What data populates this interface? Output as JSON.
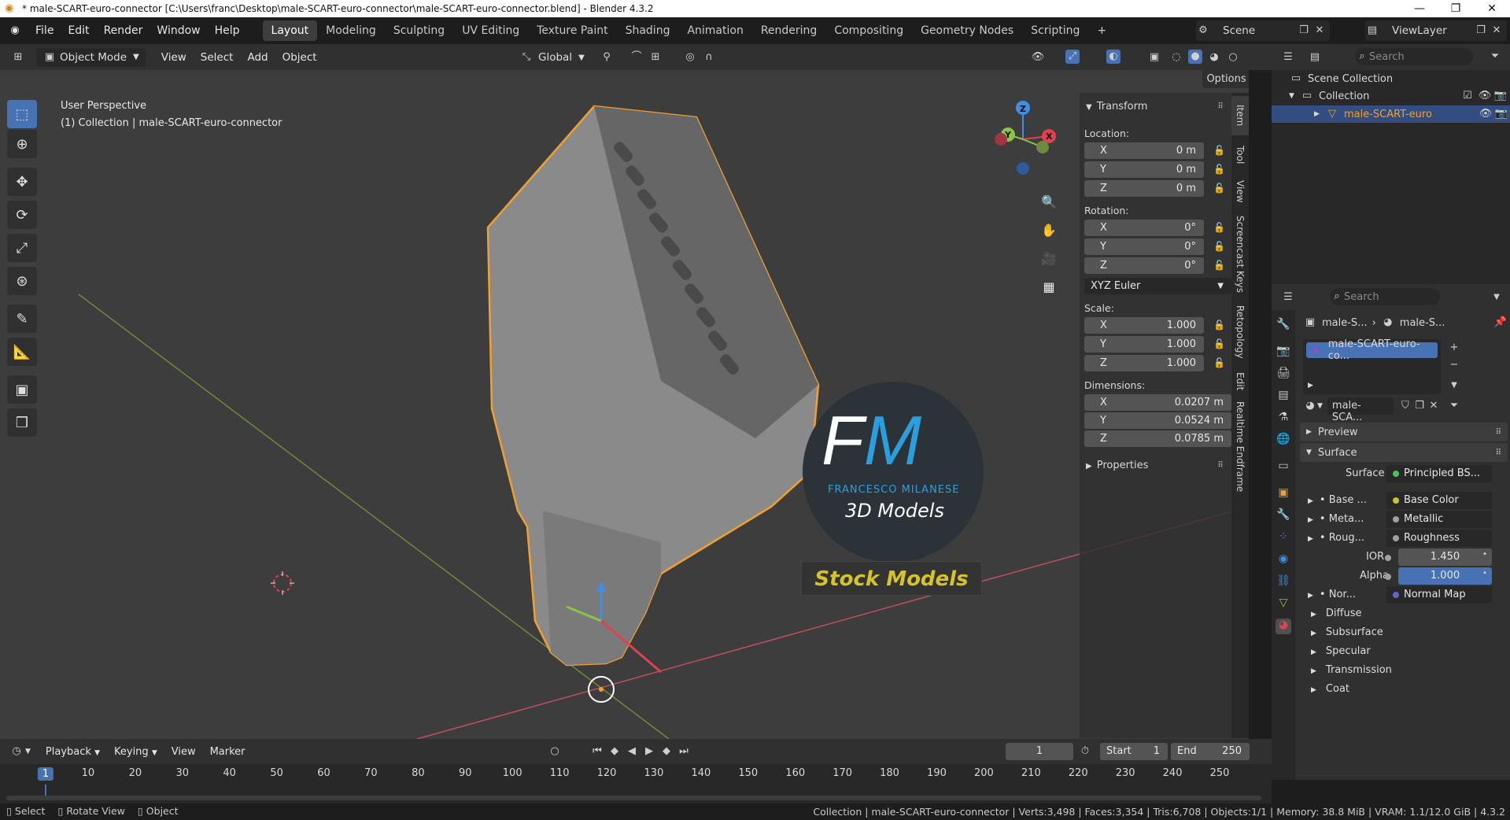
{
  "window": {
    "title": "* male-SCART-euro-connector [C:\\Users\\franc\\Desktop\\male-SCART-euro-connector\\male-SCART-euro-connector.blend] - Blender 4.3.2"
  },
  "menu": [
    "File",
    "Edit",
    "Render",
    "Window",
    "Help"
  ],
  "workspaces": [
    "Layout",
    "Modeling",
    "Sculpting",
    "UV Editing",
    "Texture Paint",
    "Shading",
    "Animation",
    "Rendering",
    "Compositing",
    "Geometry Nodes",
    "Scripting"
  ],
  "active_workspace": "Layout",
  "scene": "Scene",
  "view_layer": "ViewLayer",
  "viewport_header": {
    "mode": "Object Mode",
    "menus": [
      "View",
      "Select",
      "Add",
      "Object"
    ],
    "orientation": "Global",
    "options": "Options"
  },
  "viewport": {
    "perspective": "User Perspective",
    "collection_info": "(1) Collection | male-SCART-euro-connector"
  },
  "watermark": {
    "initials_f": "F",
    "initials_m": "M",
    "name": "FRANCESCO MILANESE",
    "sub": "3D Models",
    "banner": "Stock Models"
  },
  "transform": {
    "header": "Transform",
    "location_label": "Location:",
    "location": [
      {
        "axis": "X",
        "value": "0 m"
      },
      {
        "axis": "Y",
        "value": "0 m"
      },
      {
        "axis": "Z",
        "value": "0 m"
      }
    ],
    "rotation_label": "Rotation:",
    "rotation": [
      {
        "axis": "X",
        "value": "0°"
      },
      {
        "axis": "Y",
        "value": "0°"
      },
      {
        "axis": "Z",
        "value": "0°"
      }
    ],
    "rotation_mode": "XYZ Euler",
    "scale_label": "Scale:",
    "scale": [
      {
        "axis": "X",
        "value": "1.000"
      },
      {
        "axis": "Y",
        "value": "1.000"
      },
      {
        "axis": "Z",
        "value": "1.000"
      }
    ],
    "dimensions_label": "Dimensions:",
    "dimensions": [
      {
        "axis": "X",
        "value": "0.0207 m"
      },
      {
        "axis": "Y",
        "value": "0.0524 m"
      },
      {
        "axis": "Z",
        "value": "0.0785 m"
      }
    ],
    "properties": "Properties"
  },
  "side_tabs": [
    "Item",
    "Tool",
    "View",
    "Screencast Keys",
    "Retopology",
    "Edit",
    "Realtime Endframe"
  ],
  "outliner": {
    "search_placeholder": "Search",
    "scene_collection": "Scene Collection",
    "collection": "Collection",
    "object": "male-SCART-euro"
  },
  "properties": {
    "search_placeholder": "Search",
    "breadcrumb_obj": "male-S...",
    "breadcrumb_mat": "male-S...",
    "material_slot": "male-SCART-euro-co...",
    "material_name": "male-SCA...",
    "sections": {
      "preview": "Preview",
      "surface": "Surface"
    },
    "surface_label": "Surface",
    "surface_value": "Principled BS...",
    "inputs": [
      {
        "label": "Base ...",
        "value": "Base Color",
        "color": "#c7c729"
      },
      {
        "label": "Meta...",
        "value": "Metallic",
        "color": "#a1a1a1"
      },
      {
        "label": "Roug...",
        "value": "Roughness",
        "color": "#a1a1a1"
      }
    ],
    "ior_label": "IOR",
    "ior": "1.450",
    "alpha_label": "Alpha",
    "alpha": "1.000",
    "normal_label": "Nor...",
    "normal_value": "Normal Map",
    "subsections": [
      "Diffuse",
      "Subsurface",
      "Specular",
      "Transmission",
      "Coat"
    ]
  },
  "timeline": {
    "menus": [
      "Playback",
      "Keying",
      "View",
      "Marker"
    ],
    "current_frame": "1",
    "start_label": "Start",
    "start": "1",
    "end_label": "End",
    "end": "250",
    "ticks": [
      "1",
      "10",
      "20",
      "30",
      "40",
      "50",
      "60",
      "70",
      "80",
      "90",
      "100",
      "110",
      "120",
      "130",
      "140",
      "150",
      "160",
      "170",
      "180",
      "190",
      "200",
      "210",
      "220",
      "230",
      "240",
      "250"
    ]
  },
  "status": {
    "hints": [
      "Select",
      "Rotate View",
      "Object"
    ],
    "info": "Collection | male-SCART-euro-connector | Verts:3,498 | Faces:3,354 | Tris:6,708 | Objects:1/1 | Memory: 38.8 MiB | VRAM: 1.1/12.0 GiB | 4.3.2"
  },
  "colors": {
    "accent": "#4772b3",
    "selection": "#f0a030",
    "x_axis": "#e0414f",
    "y_axis": "#8bc34a",
    "z_axis": "#3d8fe8"
  }
}
